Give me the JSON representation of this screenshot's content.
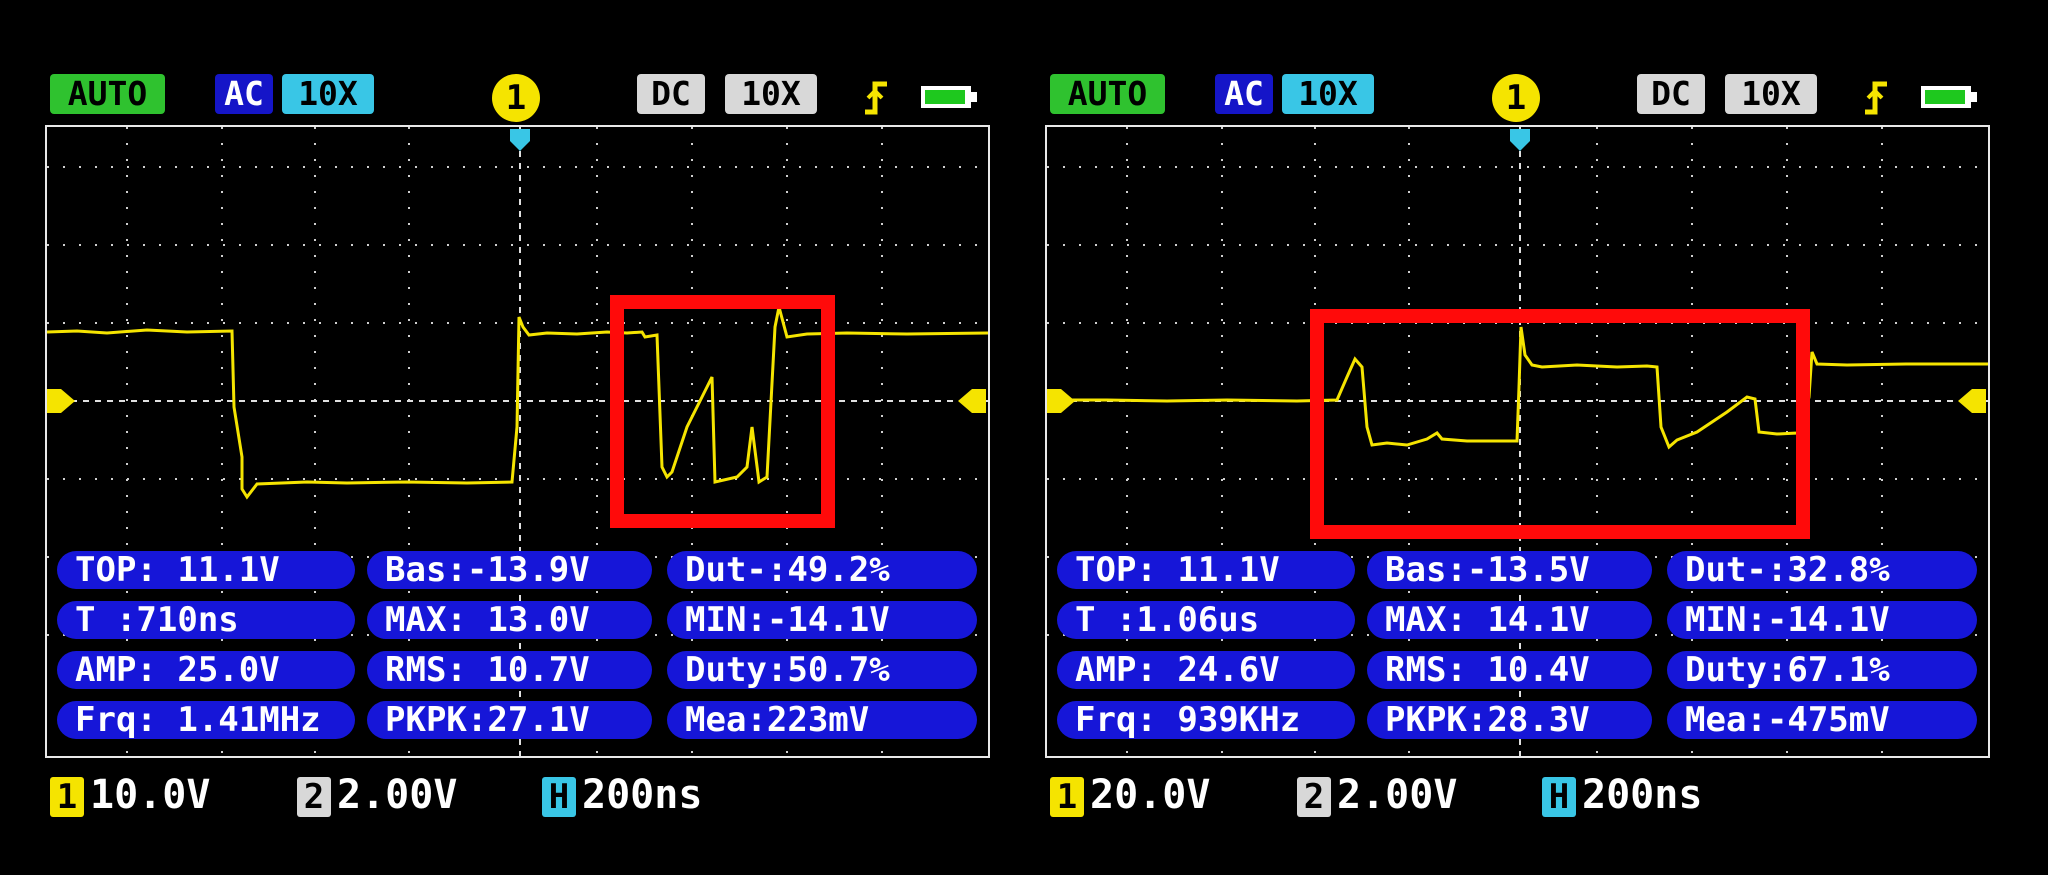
{
  "scopes": [
    {
      "header": {
        "mode": "AUTO",
        "coupling1": "AC",
        "probe1": "10X",
        "channel": "1",
        "coupling2": "DC",
        "probe2": "10X"
      },
      "measurements": [
        [
          "TOP: 11.1V",
          "Bas:-13.9V",
          "Dut-:49.2%"
        ],
        [
          "T :710ns",
          "MAX: 13.0V",
          "MIN:-14.1V"
        ],
        [
          "AMP: 25.0V",
          "RMS: 10.7V",
          "Duty:50.7%"
        ],
        [
          "Frq: 1.41MHz",
          "PKPK:27.1V",
          "Mea:223mV"
        ]
      ],
      "scale": {
        "ch1_num": "1",
        "ch1": "10.0V",
        "ch2_num": "2",
        "ch2": "2.00V",
        "h_label": "H",
        "h": "200ns"
      }
    },
    {
      "header": {
        "mode": "AUTO",
        "coupling1": "AC",
        "probe1": "10X",
        "channel": "1",
        "coupling2": "DC",
        "probe2": "10X"
      },
      "measurements": [
        [
          "TOP: 11.1V",
          "Bas:-13.5V",
          "Dut-:32.8%"
        ],
        [
          "T :1.06us",
          "MAX: 14.1V",
          "MIN:-14.1V"
        ],
        [
          "AMP: 24.6V",
          "RMS: 10.4V",
          "Duty:67.1%"
        ],
        [
          "Frq: 939KHz",
          "PKPK:28.3V",
          "Mea:-475mV"
        ]
      ],
      "scale": {
        "ch1_num": "1",
        "ch1": "20.0V",
        "ch2_num": "2",
        "ch2": "2.00V",
        "h_label": "H",
        "h": "200ns"
      }
    }
  ],
  "colors": {
    "trace": "#f5e400",
    "highlight": "#ff0a0a",
    "pill": "#1616d8",
    "grid": "#d0d0d0"
  }
}
